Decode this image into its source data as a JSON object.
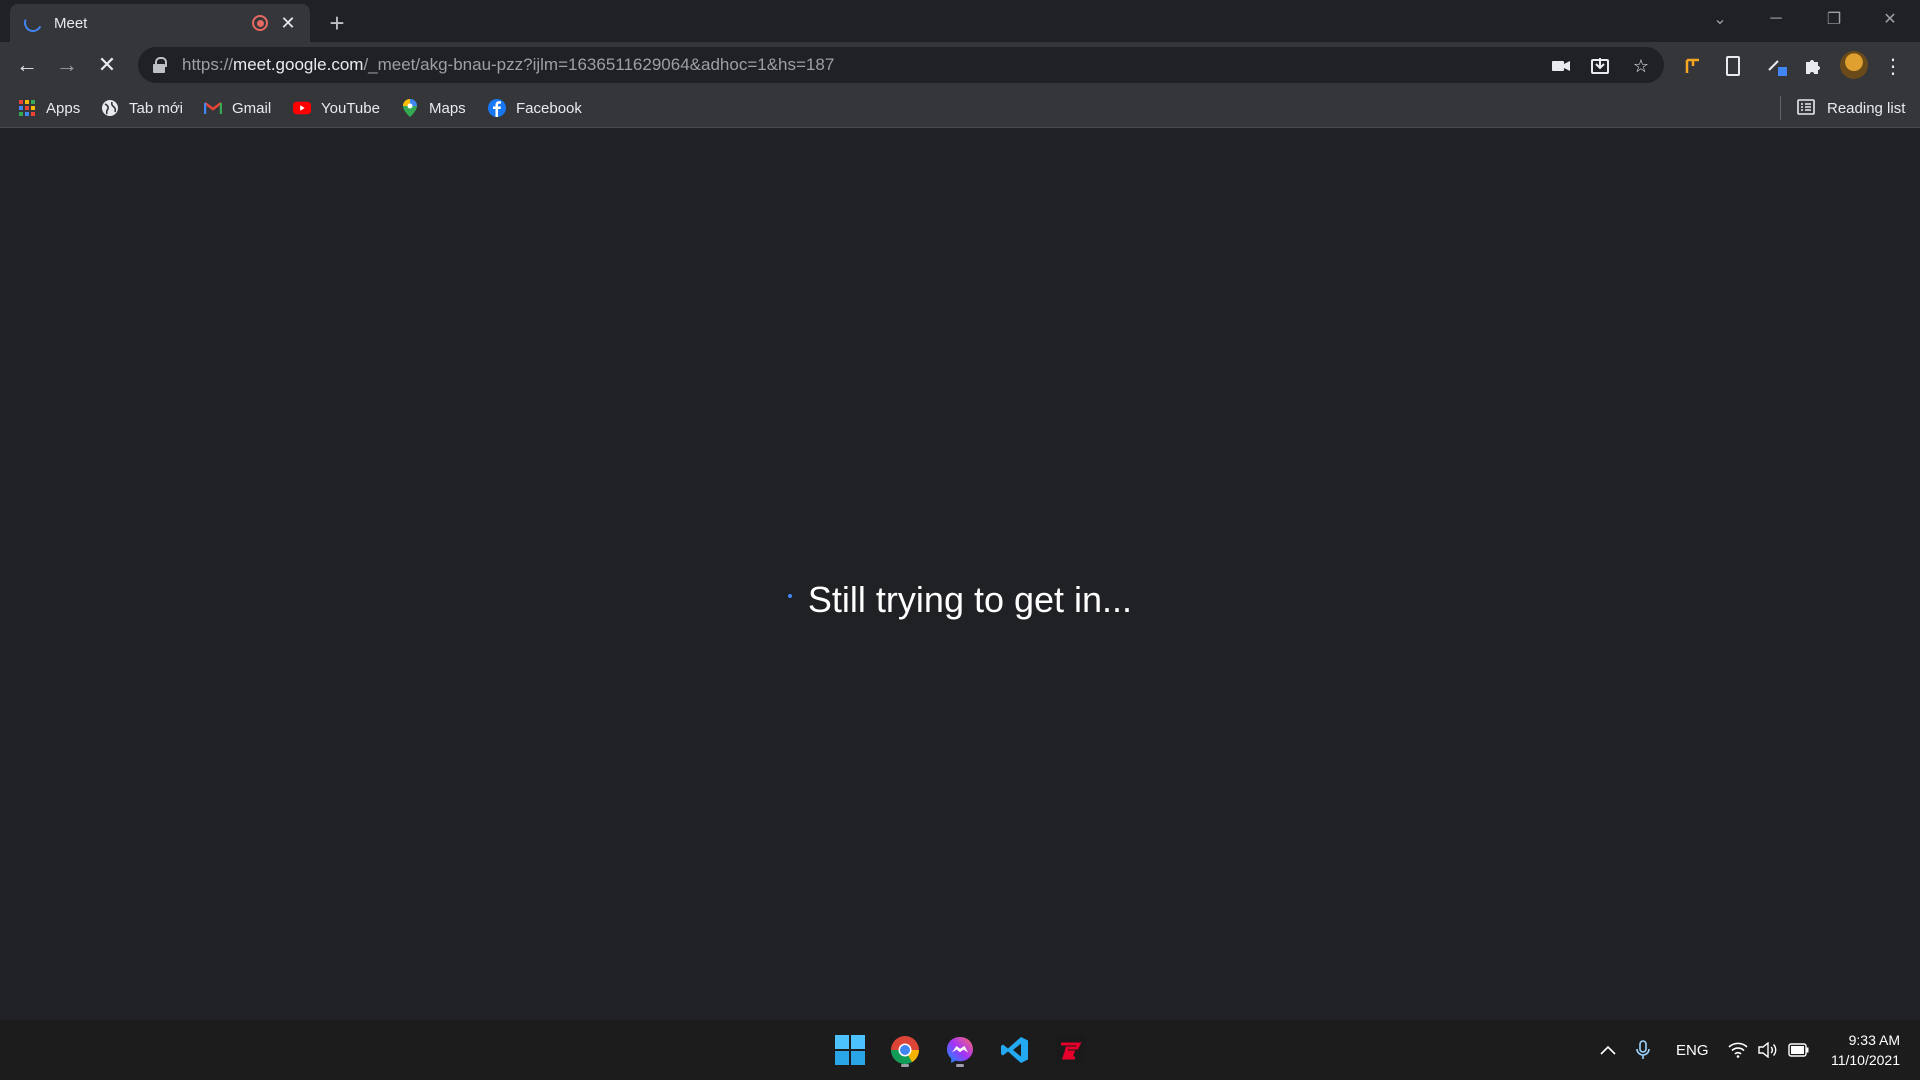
{
  "tab": {
    "title": "Meet"
  },
  "toolbar": {
    "url_scheme": "https://",
    "url_host": "meet.google.com",
    "url_path": "/_meet/akg-bnau-pzz?ijlm=1636511629064&adhoc=1&hs=187"
  },
  "bookmarks": [
    {
      "label": "Apps",
      "icon": "apps-grid-icon"
    },
    {
      "label": "Tab mới",
      "icon": "globe-icon"
    },
    {
      "label": "Gmail",
      "icon": "gmail-icon"
    },
    {
      "label": "YouTube",
      "icon": "youtube-icon"
    },
    {
      "label": "Maps",
      "icon": "maps-icon"
    },
    {
      "label": "Facebook",
      "icon": "facebook-icon"
    }
  ],
  "reading_list": {
    "label": "Reading list"
  },
  "main": {
    "status_text": "Still trying to get in..."
  },
  "taskbar": {
    "apps": [
      "windows-start-icon",
      "chrome-icon",
      "messenger-icon",
      "vscode-icon",
      "garena-icon"
    ],
    "language": "ENG",
    "time": "9:33 AM",
    "date": "11/10/2021"
  },
  "colors": {
    "accent_blue": "#4285f4",
    "background": "#202124",
    "toolbar": "#35363a"
  }
}
